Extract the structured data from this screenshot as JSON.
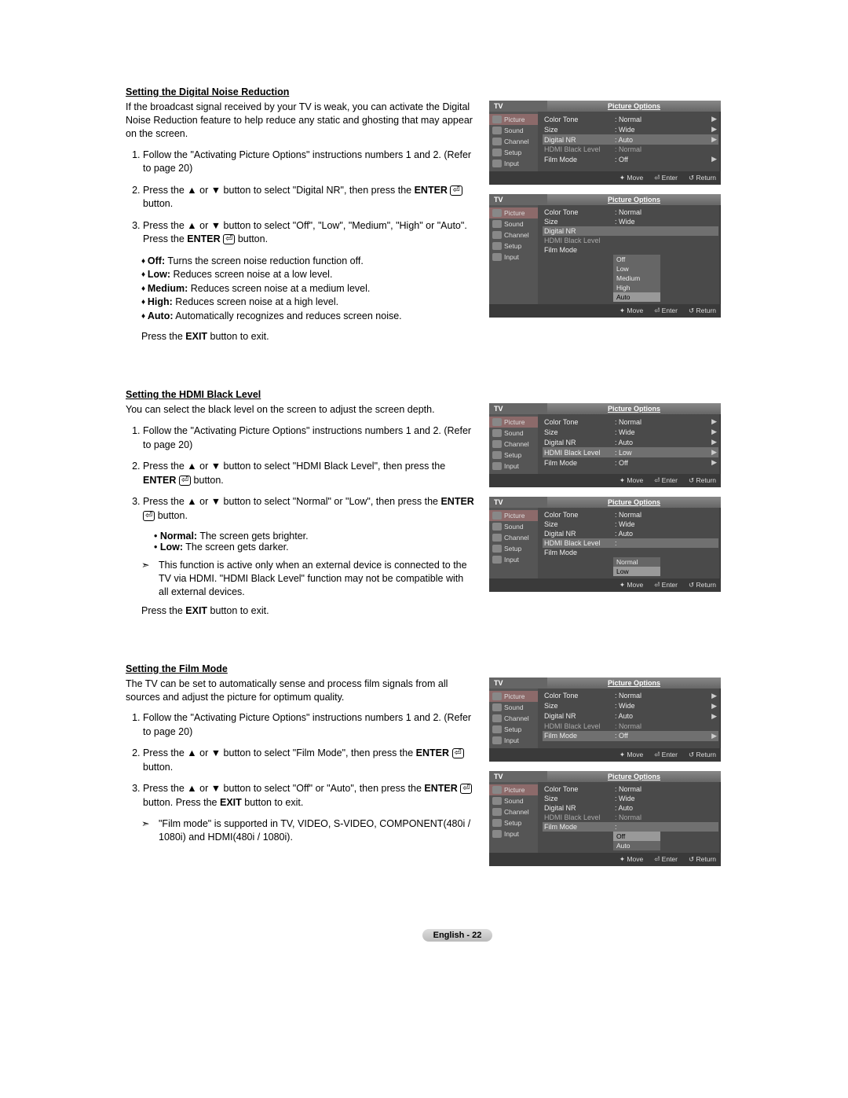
{
  "sections": [
    {
      "title": "Setting the Digital Noise Reduction",
      "intro": "If the broadcast signal received by your TV is weak, you can activate the Digital Noise Reduction feature to help reduce any static and ghosting that may appear on the screen.",
      "steps": [
        "Follow the \"Activating Picture Options\" instructions numbers 1 and 2. (Refer to page 20)",
        "Press the ▲ or ▼ button to select \"Digital NR\", then press the <b>ENTER</b> ⏎ button.",
        "Press the ▲ or ▼ button to select \"Off\", \"Low\", \"Medium\", \"High\" or \"Auto\". Press the <b>ENTER</b> ⏎ button."
      ],
      "bullets": [
        "<b>Off:</b> Turns the screen noise reduction function off.",
        "<b>Low:</b> Reduces screen noise at a low level.",
        "<b>Medium:</b> Reduces screen noise at a medium level.",
        "<b>High:</b> Reduces screen noise at a high level.",
        "<b>Auto:</b> Automatically recognizes and reduces screen noise."
      ],
      "exit": "Press the <b>EXIT</b> button to exit.",
      "figs": [
        {
          "rows": [
            {
              "lab": "Color Tone",
              "val": ": Normal",
              "arrow": true
            },
            {
              "lab": "Size",
              "val": ": Wide",
              "arrow": true
            },
            {
              "lab": "Digital NR",
              "val": ": Auto",
              "arrow": true,
              "hl": true
            },
            {
              "lab": "HDMI Black Level",
              "val": ": Normal",
              "lock": true
            },
            {
              "lab": "Film Mode",
              "val": ": Off",
              "arrow": true
            }
          ]
        },
        {
          "rows": [
            {
              "lab": "Color Tone",
              "val": ": Normal"
            },
            {
              "lab": "Size",
              "val": ": Wide"
            },
            {
              "lab": "Digital NR",
              "val": "",
              "hl": true
            },
            {
              "lab": "HDMI Black Level",
              "val": "",
              "lock": true
            },
            {
              "lab": "Film Mode",
              "val": ""
            }
          ],
          "dropdown": {
            "options": [
              "Off",
              "Low",
              "Medium",
              "High",
              "Auto"
            ],
            "sel": "Auto"
          }
        }
      ]
    },
    {
      "title": "Setting the HDMI Black Level",
      "intro": "You can select the black level on the screen to adjust the screen depth.",
      "steps": [
        "Follow the \"Activating Picture Options\" instructions numbers 1 and 2. (Refer to page 20)",
        "Press the ▲ or ▼ button to select \"HDMI Black Level\", then press the <b>ENTER</b> ⏎ button.",
        "Press the ▲ or ▼ button to select \"Normal\" or \"Low\", then press the <b>ENTER</b> ⏎ button."
      ],
      "bulletsSimple": [
        "<b>Normal:</b> The screen gets brighter.",
        "<b>Low:</b> The screen gets darker."
      ],
      "note": "This function is active only when an external device is connected to the TV via HDMI. \"HDMI Black Level\" function may not be compatible with all external devices.",
      "exit": "Press the <b>EXIT</b> button to exit.",
      "figs": [
        {
          "rows": [
            {
              "lab": "Color Tone",
              "val": ": Normal",
              "arrow": true
            },
            {
              "lab": "Size",
              "val": ": Wide",
              "arrow": true
            },
            {
              "lab": "Digital NR",
              "val": ": Auto",
              "arrow": true
            },
            {
              "lab": "HDMI Black Level",
              "val": ": Low",
              "arrow": true,
              "hl": true
            },
            {
              "lab": "Film Mode",
              "val": ": Off",
              "arrow": true
            }
          ]
        },
        {
          "rows": [
            {
              "lab": "Color Tone",
              "val": ": Normal"
            },
            {
              "lab": "Size",
              "val": ": Wide"
            },
            {
              "lab": "Digital NR",
              "val": ": Auto"
            },
            {
              "lab": "HDMI Black Level",
              "val": ":",
              "hl": true
            },
            {
              "lab": "Film Mode",
              "val": ""
            }
          ],
          "dropdown": {
            "options": [
              "Normal",
              "Low"
            ],
            "sel": "Low"
          }
        }
      ]
    },
    {
      "title": "Setting the Film Mode",
      "intro": "The TV can be set to automatically sense and process film signals from all sources and adjust the picture for optimum quality.",
      "steps": [
        "Follow the \"Activating Picture Options\" instructions numbers 1 and 2. (Refer to page 20)",
        "Press the ▲ or ▼ button to select \"Film Mode\", then press the <b>ENTER</b> ⏎ button.",
        "Press the ▲ or ▼ button to select \"Off\" or \"Auto\", then press the <b>ENTER</b> ⏎ button. Press the <b>EXIT</b> button to exit."
      ],
      "note": "\"Film mode\" is supported in TV, VIDEO, S-VIDEO, COMPONENT(480i / 1080i) and HDMI(480i / 1080i).",
      "figs": [
        {
          "rows": [
            {
              "lab": "Color Tone",
              "val": ": Normal",
              "arrow": true
            },
            {
              "lab": "Size",
              "val": ": Wide",
              "arrow": true
            },
            {
              "lab": "Digital NR",
              "val": ": Auto",
              "arrow": true
            },
            {
              "lab": "HDMI Black Level",
              "val": ": Normal",
              "lock": true
            },
            {
              "lab": "Film Mode",
              "val": ": Off",
              "arrow": true,
              "hl": true
            }
          ]
        },
        {
          "rows": [
            {
              "lab": "Color Tone",
              "val": ": Normal"
            },
            {
              "lab": "Size",
              "val": ": Wide"
            },
            {
              "lab": "Digital NR",
              "val": ": Auto"
            },
            {
              "lab": "HDMI Black Level",
              "val": ": Normal",
              "lock": true
            },
            {
              "lab": "Film Mode",
              "val": ":",
              "hl": true
            }
          ],
          "dropdown": {
            "options": [
              "Off",
              "Auto"
            ],
            "sel": "Off"
          }
        }
      ]
    }
  ],
  "osd": {
    "tv": "TV",
    "title": "Picture Options",
    "cats": [
      "Picture",
      "Sound",
      "Channel",
      "Setup",
      "Input"
    ],
    "footer": {
      "move": "Move",
      "enter": "Enter",
      "return": "Return"
    }
  },
  "footer": "English - 22"
}
